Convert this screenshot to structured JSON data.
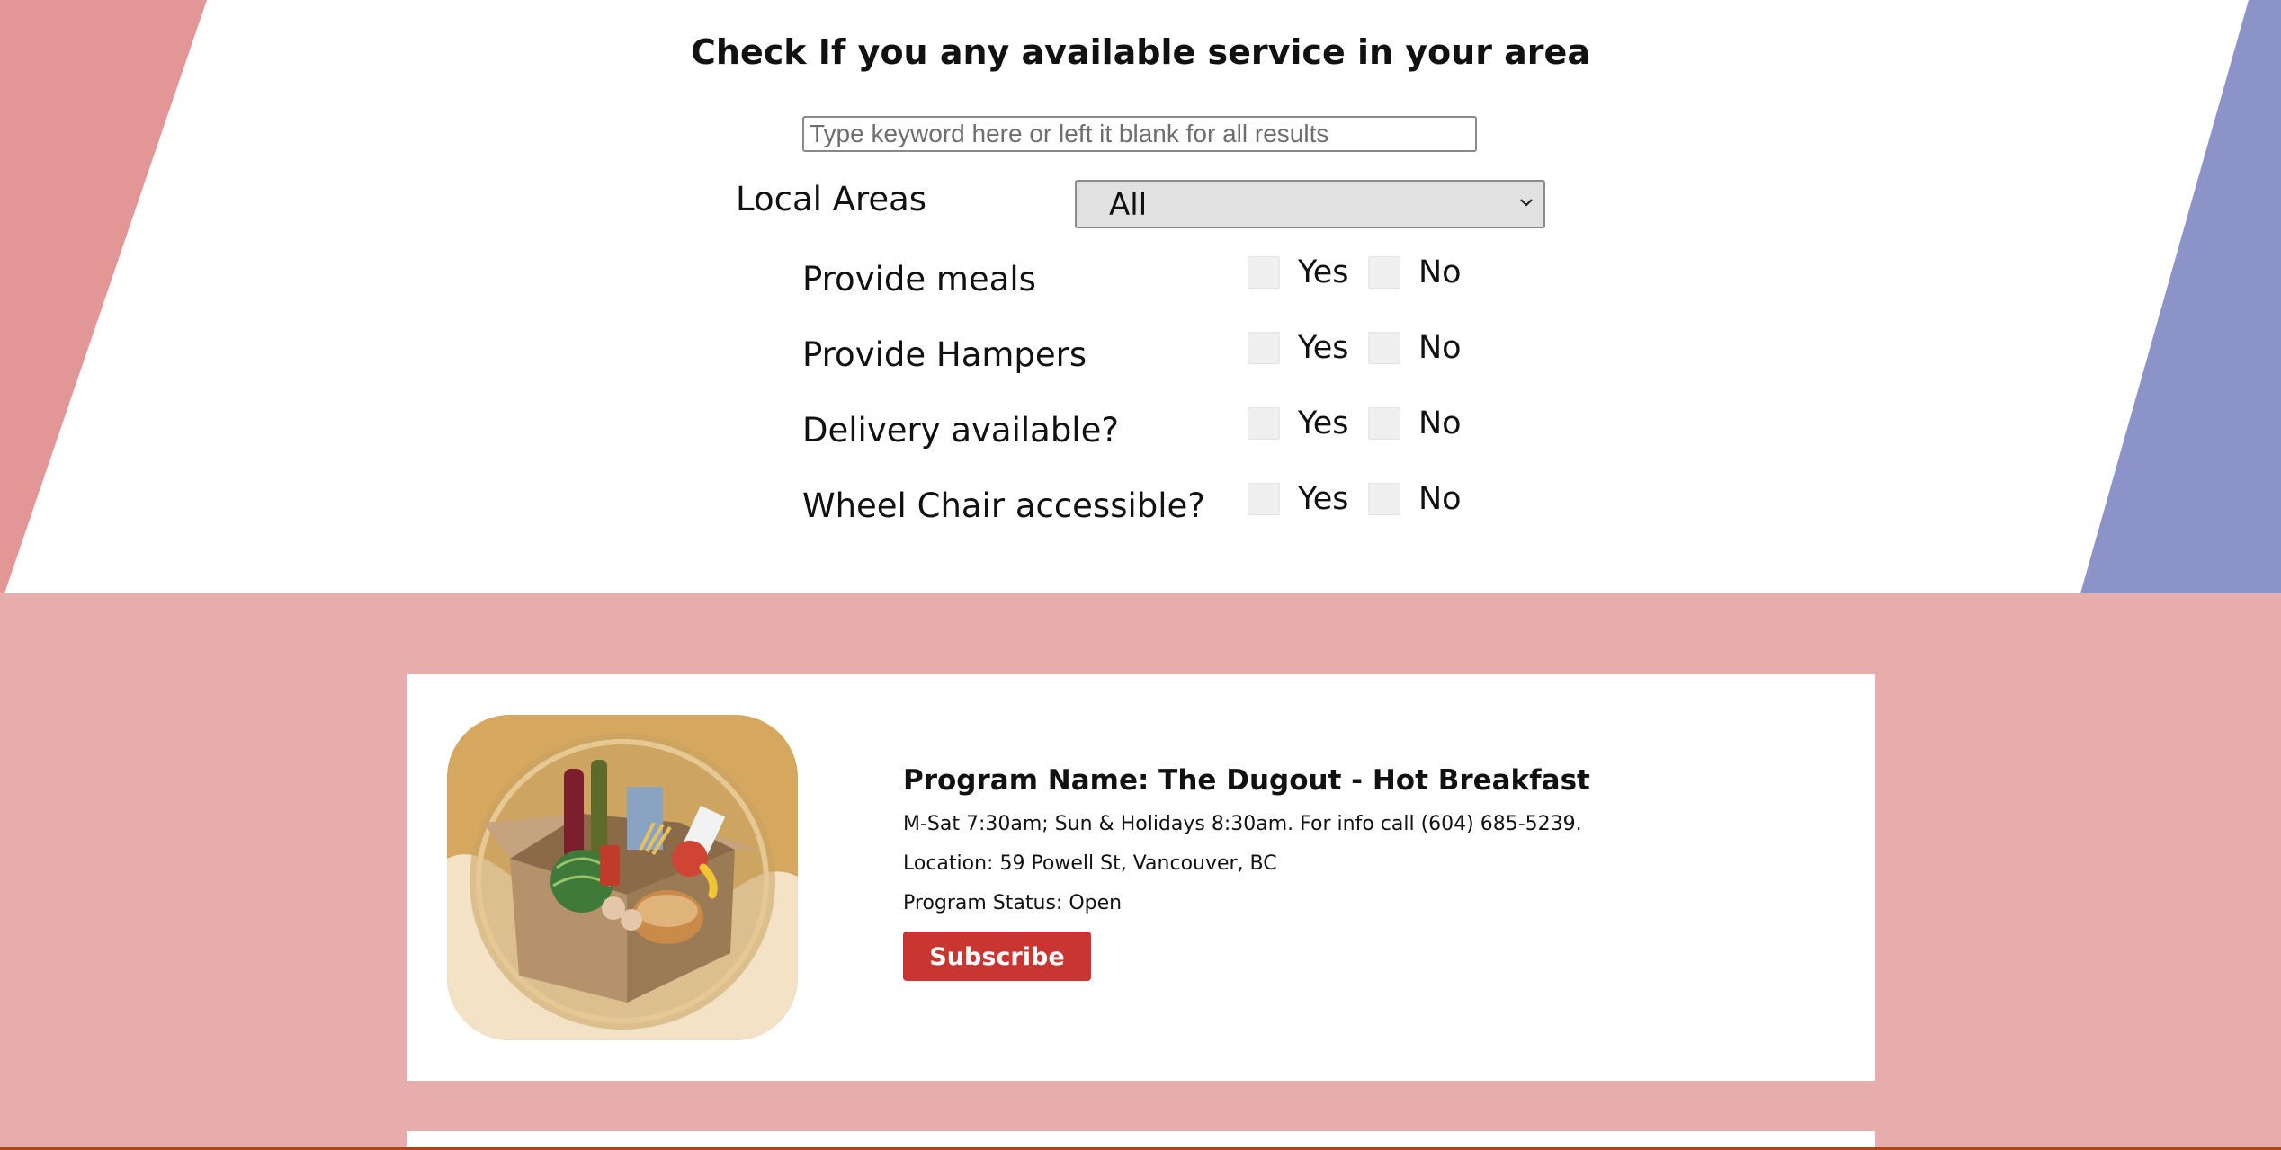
{
  "colors": {
    "left_stripe": "#e29796",
    "right_stripe": "#8b93c9",
    "list_background": "#e7adac",
    "subscribe_button": "#c93530"
  },
  "search": {
    "title": "Check If you any available service in your area",
    "placeholder": "Type keyword here or left it blank for all results"
  },
  "area_filter": {
    "label": "Local Areas",
    "selected": "All"
  },
  "filters": [
    {
      "label": "Provide meals",
      "yes_label": "Yes",
      "no_label": "No"
    },
    {
      "label": "Provide Hampers",
      "yes_label": "Yes",
      "no_label": "No"
    },
    {
      "label": "Delivery available?",
      "yes_label": "Yes",
      "no_label": "No"
    },
    {
      "label": "Wheel Chair accessible?",
      "yes_label": "Yes",
      "no_label": "No"
    }
  ],
  "programs": [
    {
      "name": "Program Name: The Dugout - Hot Breakfast",
      "hours": "M-Sat 7:30am; Sun & Holidays 8:30am. For info call (604) 685-5239.",
      "location": "Location: 59 Powell St, Vancouver, BC",
      "status": "Program Status: Open",
      "image_icon": "food-box-icon",
      "subscribe_label": "Subscribe"
    }
  ]
}
